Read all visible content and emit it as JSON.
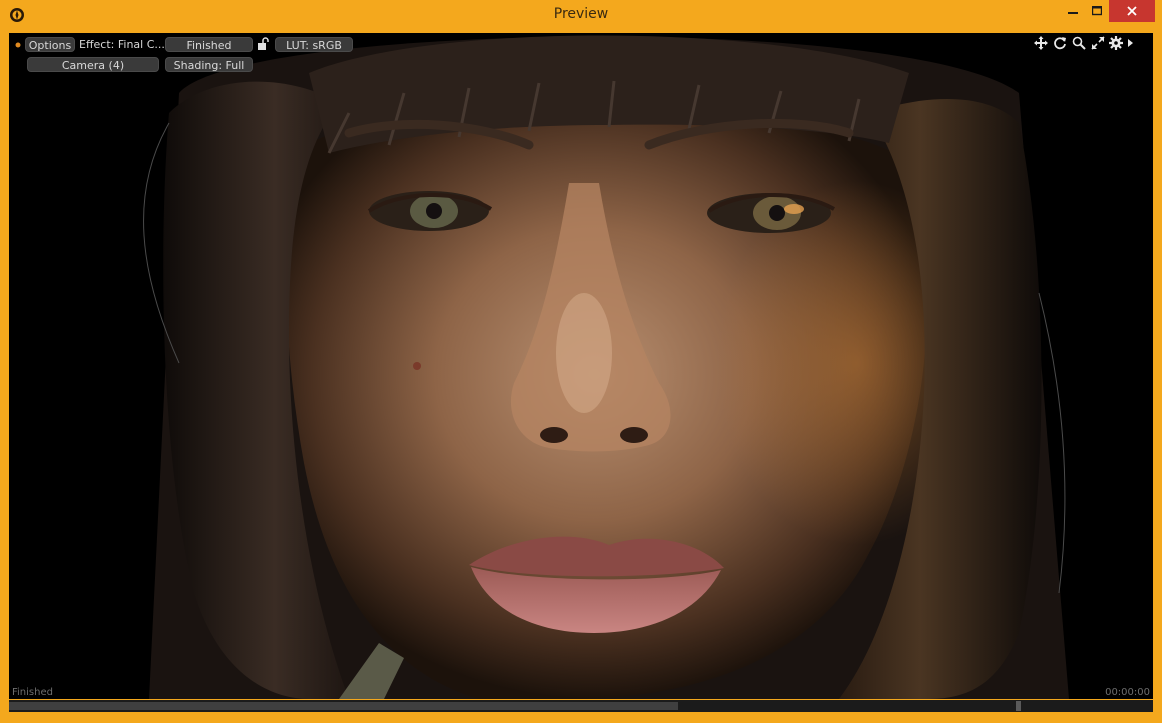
{
  "window": {
    "title": "Preview",
    "accent_color": "#f4a81d",
    "close_color": "#c7362f",
    "controls": [
      "minimize-icon",
      "maximize-icon",
      "close-icon"
    ]
  },
  "toolbar": {
    "options_label": "Options",
    "effect_label": "Effect: Final C...",
    "status_label": "Finished",
    "lock_icon": "unlock-icon",
    "lut_label": "LUT: sRGB",
    "camera_label": "Camera (4)",
    "shading_label": "Shading: Full",
    "tools": [
      "move-icon",
      "rotate-icon",
      "zoom-icon",
      "fit-icon",
      "settings-icon",
      "expand-arrow-icon"
    ]
  },
  "viewport": {
    "status_text": "Finished",
    "timecode": "00:00:00",
    "background_color": "#000000"
  },
  "timeline": {
    "progress": 0.585,
    "handle_position": 0.88
  }
}
